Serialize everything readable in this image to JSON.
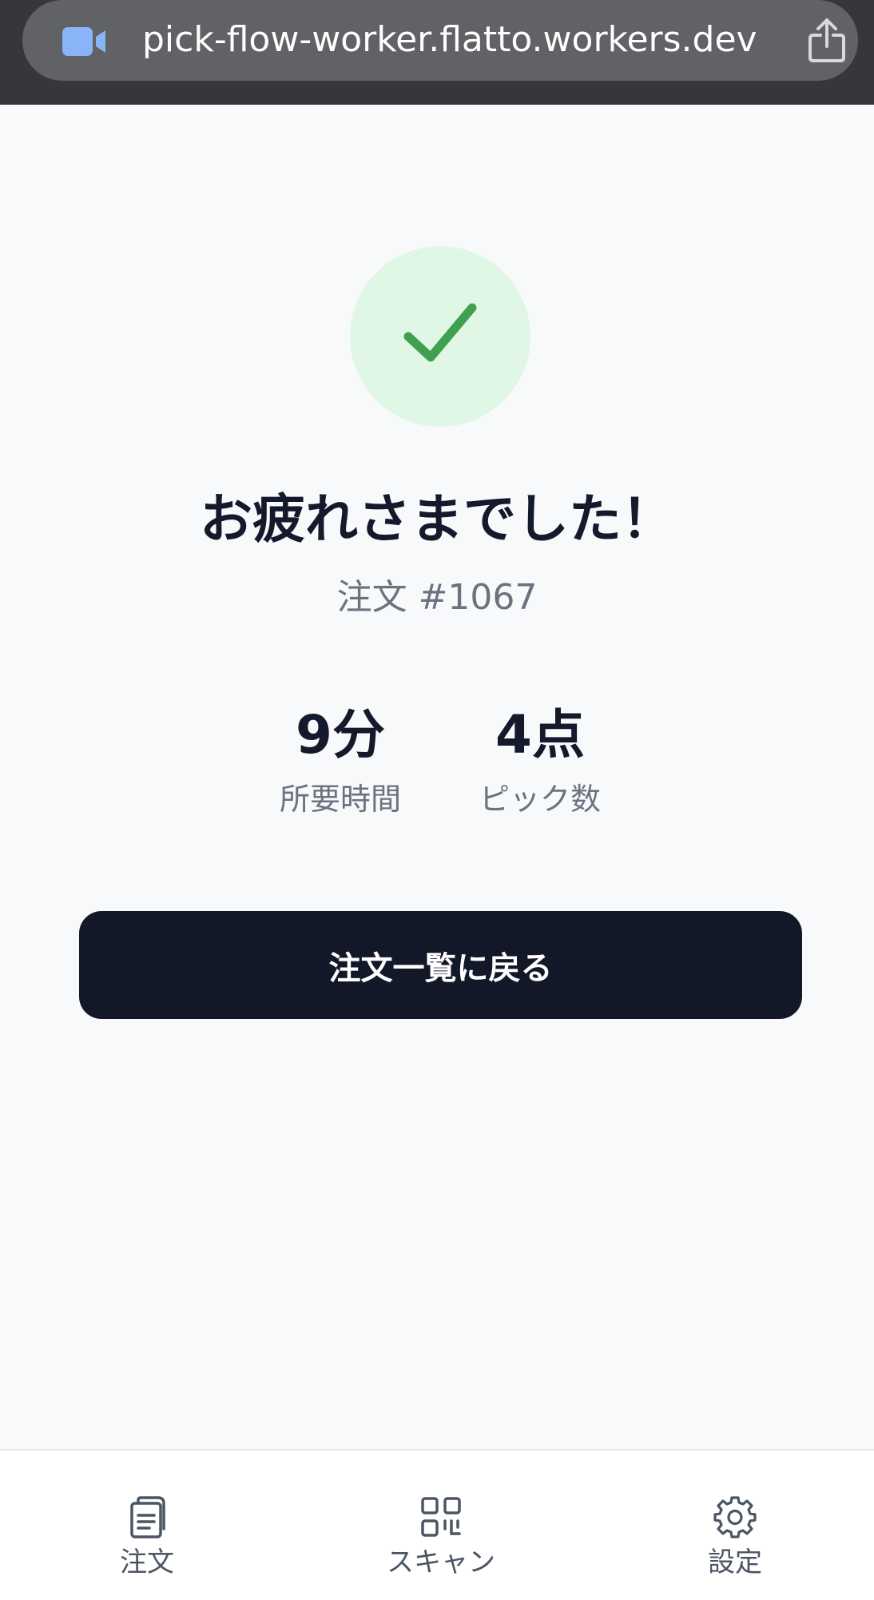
{
  "browser": {
    "url": "pick-flow-worker.flatto.workers.dev",
    "left_icon": "video-camera-icon",
    "right_icon": "share-icon",
    "accent_color": "#8ab4f8"
  },
  "completion": {
    "icon": "checkmark-icon",
    "icon_color": "#3fa04f",
    "circle_color": "#dff7e4",
    "title": "お疲れさまでした！",
    "order_label": "注文 #1067"
  },
  "stats": {
    "time": {
      "value": "9分",
      "label": "所要時間"
    },
    "picks": {
      "value": "4点",
      "label": "ピック数"
    }
  },
  "actions": {
    "back_label": "注文一覧に戻る"
  },
  "nav": {
    "items": [
      {
        "label": "注文",
        "icon": "clipboard-list-icon"
      },
      {
        "label": "スキャン",
        "icon": "qr-code-icon"
      },
      {
        "label": "設定",
        "icon": "gear-icon"
      }
    ]
  }
}
